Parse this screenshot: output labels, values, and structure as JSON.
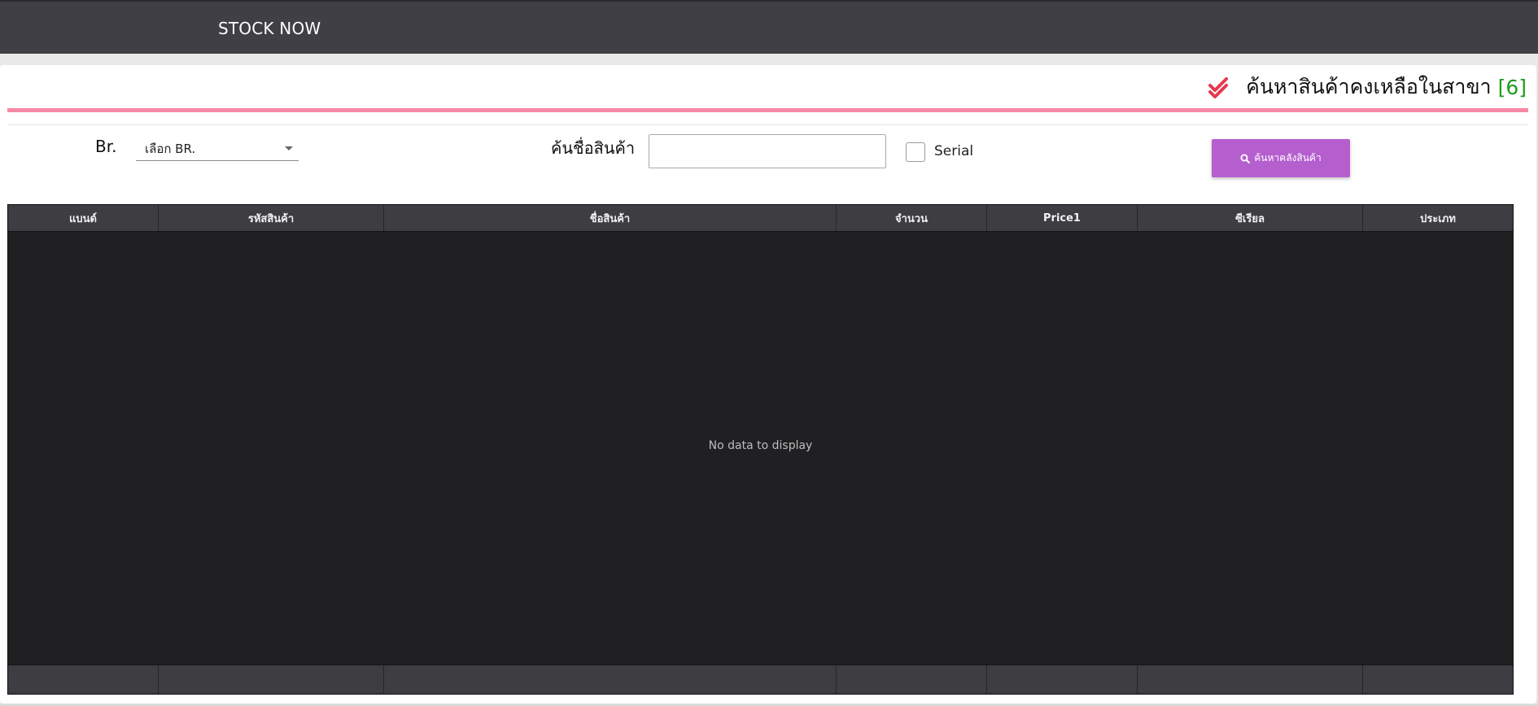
{
  "topbar": {
    "title": "STOCK NOW"
  },
  "page": {
    "heading": "ค้นหาสินค้าคงเหลือในสาขา",
    "heading_count": "[6]",
    "icons": {
      "heading": "double-check-icon",
      "search": "search-icon"
    },
    "accent_color": "#f58aa7",
    "check_color": "#e8384f",
    "count_color": "#1e9c1e"
  },
  "filters": {
    "branch_label": "Br.",
    "branch_selected": "เลือก BR.",
    "product_name_label": "ค้นชื่อสินค้า",
    "product_name_value": "",
    "serial_label": "Serial",
    "serial_checked": false,
    "search_button_label": "ค้นหาคลังสินค้า",
    "search_button_color": "#b55fcf"
  },
  "grid": {
    "columns": [
      "แบนด์",
      "รหัสสินค้า",
      "ชื่อสินค้า",
      "จำนวน",
      "Price1",
      "ซีเรียล",
      "ประเภท"
    ],
    "rows": [],
    "empty_text": "No data to display"
  }
}
